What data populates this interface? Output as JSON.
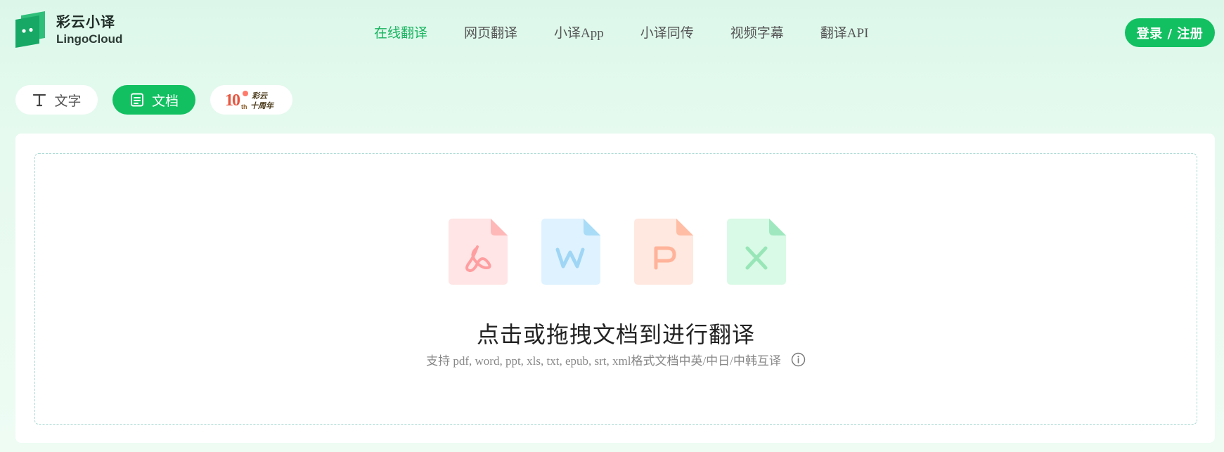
{
  "brand": {
    "name_cn": "彩云小译",
    "name_en": "LingoCloud",
    "logo_icon": "lingocloud-logo-icon",
    "accent": "#12c061"
  },
  "nav": {
    "items": [
      {
        "label": "在线翻译",
        "active": true
      },
      {
        "label": "网页翻译",
        "active": false
      },
      {
        "label": "小译App",
        "active": false
      },
      {
        "label": "小译同传",
        "active": false
      },
      {
        "label": "视频字幕",
        "active": false
      },
      {
        "label": "翻译API",
        "active": false
      }
    ]
  },
  "auth": {
    "login_label": "登录 / 注册"
  },
  "mode_tabs": {
    "text_label": "文字",
    "text_icon": "text-t-icon",
    "doc_label": "文档",
    "doc_icon": "document-icon",
    "anniv_number": "10",
    "anniv_suffix": "th",
    "anniv_line1": "彩云",
    "anniv_line2": "十周年"
  },
  "upload": {
    "file_types": [
      {
        "name": "pdf-file-icon",
        "color": "#ffe5e5",
        "accent": "#ffb8b8"
      },
      {
        "name": "word-file-icon",
        "color": "#dff2ff",
        "accent": "#a9dcf7"
      },
      {
        "name": "ppt-file-icon",
        "color": "#ffe8df",
        "accent": "#ffbda6"
      },
      {
        "name": "excel-file-icon",
        "color": "#d9fae6",
        "accent": "#9fe8bf"
      }
    ],
    "title": "点击或拖拽文档到进行翻译",
    "subtitle": "支持 pdf, word, ppt, xls, txt, epub, srt, xml格式文档中英/中日/中韩互译",
    "info_icon": "info-icon"
  }
}
